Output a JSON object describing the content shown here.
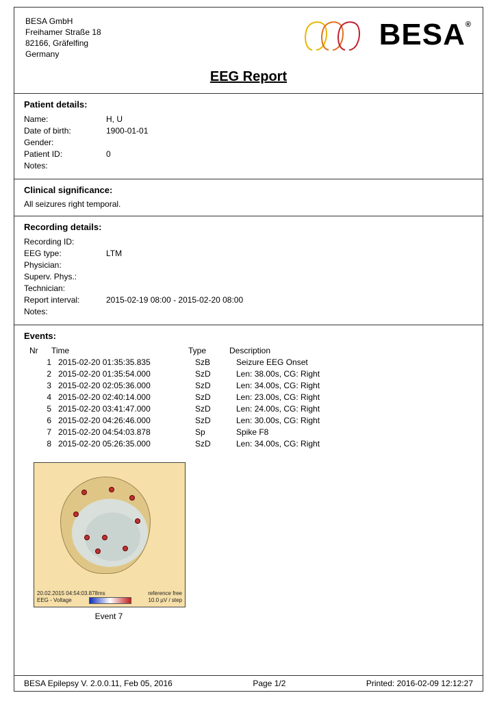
{
  "company": {
    "name": "BESA GmbH",
    "street": "Freihamer Straße 18",
    "city": "82166, Gräfelfing",
    "country": "Germany",
    "logo_text": "BESA"
  },
  "title": "EEG Report",
  "patient": {
    "section": "Patient details:",
    "labels": {
      "name": "Name:",
      "dob": "Date of birth:",
      "gender": "Gender:",
      "pid": "Patient ID:",
      "notes": "Notes:"
    },
    "values": {
      "name": "H, U",
      "dob": "1900-01-01",
      "gender": "",
      "pid": "0",
      "notes": ""
    }
  },
  "clinical": {
    "section": "Clinical significance:",
    "text": "All seizures right temporal."
  },
  "recording": {
    "section": "Recording details:",
    "labels": {
      "rid": "Recording ID:",
      "eeg": "EEG type:",
      "phys": "Physician:",
      "sup": "Superv. Phys.:",
      "tech": "Technician:",
      "interval": "Report interval:",
      "notes": "Notes:"
    },
    "values": {
      "rid": "",
      "eeg": "LTM",
      "phys": "",
      "sup": "",
      "tech": "",
      "interval": "2015-02-19 08:00 - 2015-02-20 08:00",
      "notes": ""
    }
  },
  "events": {
    "section": "Events:",
    "headers": {
      "nr": "Nr",
      "time": "Time",
      "type": "Type",
      "desc": "Description"
    },
    "rows": [
      {
        "nr": "1",
        "time": "2015-02-20 01:35:35.835",
        "type": "SzB",
        "desc": "Seizure EEG Onset"
      },
      {
        "nr": "2",
        "time": "2015-02-20 01:35:54.000",
        "type": "SzD",
        "desc": "Len: 38.00s, CG: Right"
      },
      {
        "nr": "3",
        "time": "2015-02-20 02:05:36.000",
        "type": "SzD",
        "desc": "Len: 34.00s, CG: Right"
      },
      {
        "nr": "4",
        "time": "2015-02-20 02:40:14.000",
        "type": "SzD",
        "desc": "Len: 23.00s, CG: Right"
      },
      {
        "nr": "5",
        "time": "2015-02-20 03:41:47.000",
        "type": "SzD",
        "desc": "Len: 24.00s, CG: Right"
      },
      {
        "nr": "6",
        "time": "2015-02-20 04:26:46.000",
        "type": "SzD",
        "desc": "Len: 30.00s, CG: Right"
      },
      {
        "nr": "7",
        "time": "2015-02-20 04:54:03.878",
        "type": "Sp",
        "desc": "Spike F8"
      },
      {
        "nr": "8",
        "time": "2015-02-20 05:26:35.000",
        "type": "SzD",
        "desc": "Len: 34.00s, CG: Right"
      }
    ]
  },
  "figure": {
    "caption": "Event 7",
    "timestamp": "20.02.2015 04:54:03.878ms",
    "ref": "reference free",
    "signal": "EEG - Voltage",
    "scale": "10.0 µV / step"
  },
  "footer": {
    "version": "BESA Epilepsy V. 2.0.0.11, Feb 05, 2016",
    "page": "Page 1/2",
    "printed": "Printed: 2016-02-09 12:12:27"
  }
}
